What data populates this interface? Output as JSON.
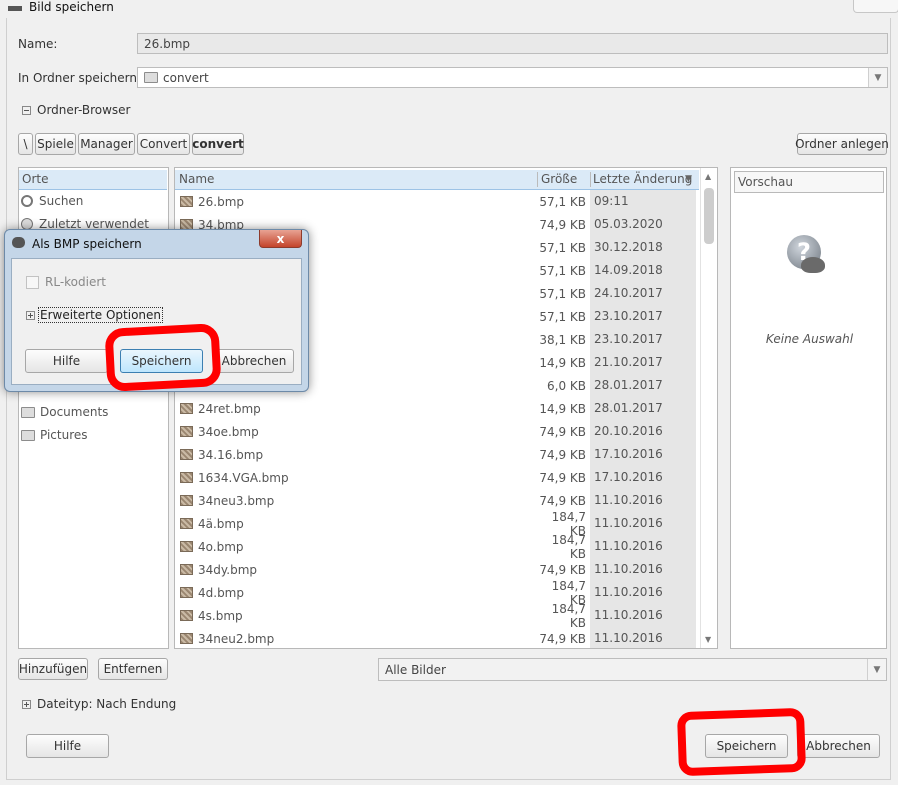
{
  "window": {
    "title": "Bild speichern"
  },
  "name_label": "Name:",
  "name_value": "26.bmp",
  "folder_label": "In Ordner speichern:",
  "folder_value": "convert",
  "browser_toggle": "Ordner-Browser",
  "path": [
    "\\",
    "Spiele",
    "Manager",
    "Convert",
    "convert"
  ],
  "create_folder": "Ordner anlegen",
  "places": {
    "header": "Orte",
    "items": [
      {
        "label": "Suchen",
        "icon": "search-icon"
      },
      {
        "label": "Zuletzt verwendet",
        "icon": "recent-icon"
      },
      {
        "label": "Documents",
        "icon": "folder-icon"
      },
      {
        "label": "Pictures",
        "icon": "folder-icon"
      }
    ]
  },
  "files": {
    "columns": [
      "Name",
      "Größe",
      "Letzte Änderung"
    ],
    "rows": [
      {
        "name": "26.bmp",
        "size": "57,1 KB",
        "date": "09:11"
      },
      {
        "name": "34.bmp",
        "size": "74,9 KB",
        "date": "05.03.2020"
      },
      {
        "name": "",
        "size": "57,1 KB",
        "date": "30.12.2018"
      },
      {
        "name": "",
        "size": "57,1 KB",
        "date": "14.09.2018"
      },
      {
        "name": "",
        "size": "57,1 KB",
        "date": "24.10.2017"
      },
      {
        "name": "",
        "size": "57,1 KB",
        "date": "23.10.2017"
      },
      {
        "name": "",
        "size": "38,1 KB",
        "date": "23.10.2017"
      },
      {
        "name": "",
        "size": "14,9 KB",
        "date": "21.10.2017"
      },
      {
        "name": "",
        "size": "6,0 KB",
        "date": "28.01.2017"
      },
      {
        "name": "24ret.bmp",
        "size": "14,9 KB",
        "date": "28.01.2017"
      },
      {
        "name": "34oe.bmp",
        "size": "74,9 KB",
        "date": "20.10.2016"
      },
      {
        "name": "34.16.bmp",
        "size": "74,9 KB",
        "date": "17.10.2016"
      },
      {
        "name": "1634.VGA.bmp",
        "size": "74,9 KB",
        "date": "17.10.2016"
      },
      {
        "name": "34neu3.bmp",
        "size": "74,9 KB",
        "date": "11.10.2016"
      },
      {
        "name": "4ä.bmp",
        "size": "184,7 KB",
        "date": "11.10.2016"
      },
      {
        "name": "4o.bmp",
        "size": "184,7 KB",
        "date": "11.10.2016"
      },
      {
        "name": "34dy.bmp",
        "size": "74,9 KB",
        "date": "11.10.2016"
      },
      {
        "name": "4d.bmp",
        "size": "184,7 KB",
        "date": "11.10.2016"
      },
      {
        "name": "4s.bmp",
        "size": "184,7 KB",
        "date": "11.10.2016"
      },
      {
        "name": "34neu2.bmp",
        "size": "74,9 KB",
        "date": "11.10.2016"
      }
    ]
  },
  "preview": {
    "header": "Vorschau",
    "empty": "Keine Auswahl"
  },
  "add_button": "Hinzufügen",
  "remove_button": "Entfernen",
  "filter_value": "Alle Bilder",
  "filetype_toggle": "Dateityp: Nach Endung",
  "help_button": "Hilfe",
  "save_button": "Speichern",
  "cancel_button": "Abbrechen",
  "bmp_dialog": {
    "title": "Als BMP speichern",
    "rle_label": "RL-kodiert",
    "advanced_label": "Erweiterte Optionen",
    "help_button": "Hilfe",
    "save_button": "Speichern",
    "cancel_button": "Abbrechen",
    "close_label": "x"
  },
  "colors": {
    "highlight": "#ff0000",
    "selection": "#dbeaf7"
  }
}
